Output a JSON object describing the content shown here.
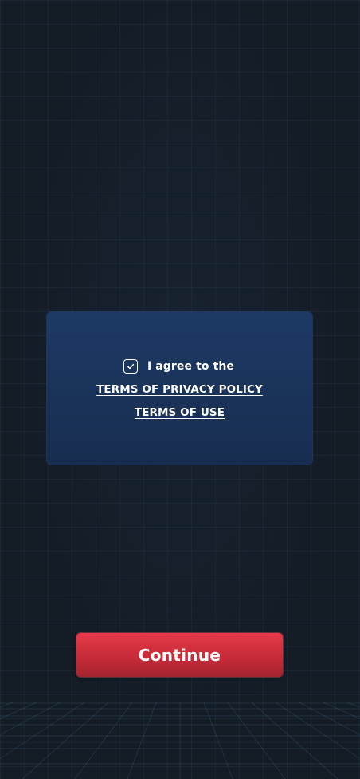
{
  "agreement": {
    "checked": true,
    "agree_label": "I agree to the",
    "privacy_link": "TERMS OF PRIVACY POLICY",
    "terms_link": "TERMS OF USE"
  },
  "actions": {
    "continue_label": "Continue"
  },
  "icons": {
    "checkbox": "check-icon"
  },
  "colors": {
    "background": "#141c26",
    "card": "#1d3a66",
    "accent_button": "#e63a48",
    "text": "#ffffff"
  }
}
